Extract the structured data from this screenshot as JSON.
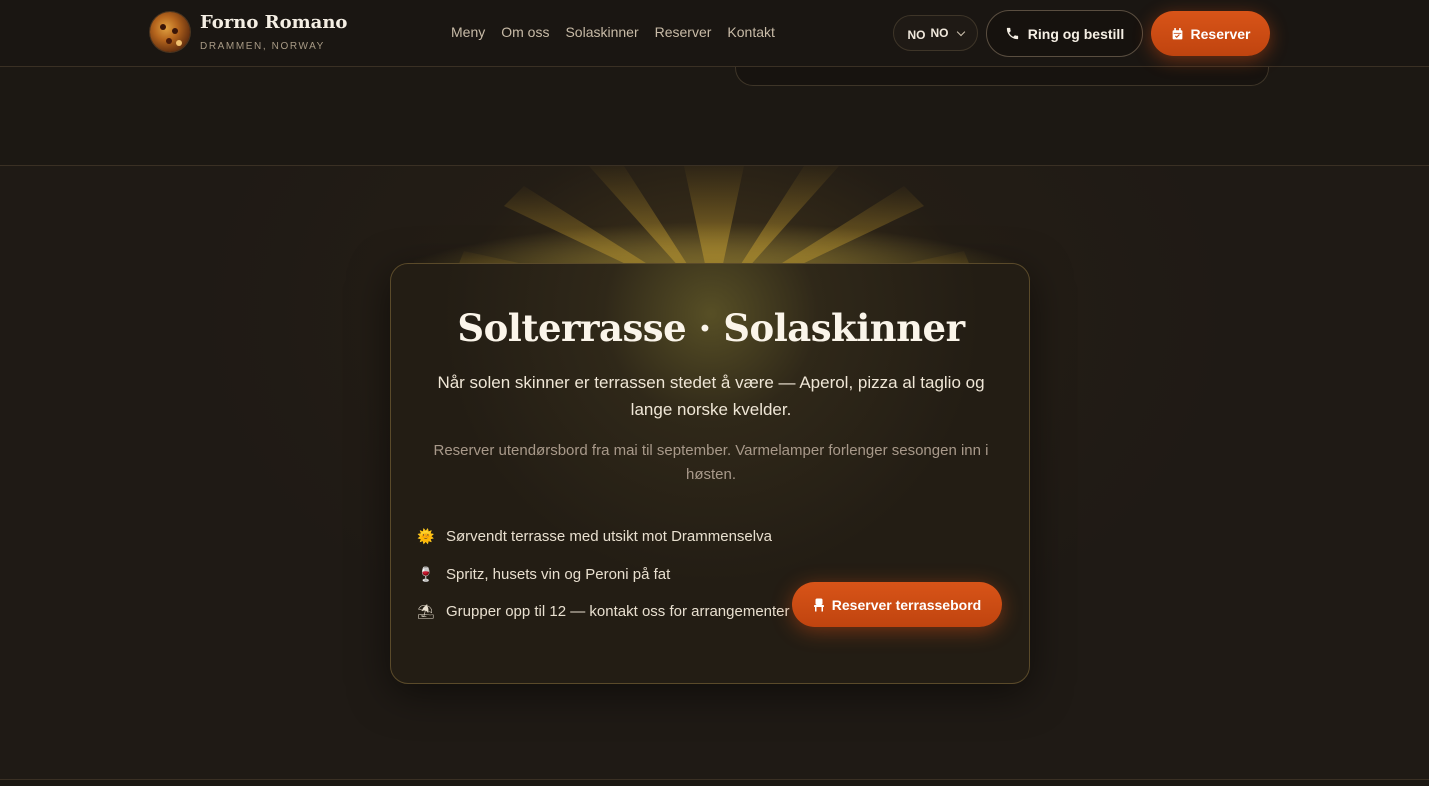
{
  "header": {
    "brand_name": "Forno Romano",
    "brand_sub": "DRAMMEN, NORWAY",
    "nav": [
      "Meny",
      "Om oss",
      "Solaskinner",
      "Reserver",
      "Kontakt"
    ],
    "lang_flag": "NO",
    "lang_label": "NO",
    "call_label": "Ring og bestill",
    "reserve_label": "Reserver"
  },
  "terrace": {
    "title": "Solterrasse · Solaskinner",
    "lead": "Når solen skinner er terrassen stedet å være — Aperol, pizza al taglio og lange norske kvelder.",
    "note": "Reserver utendørsbord fra mai til september. Varmelamper forlenger sesongen inn i høsten.",
    "features": [
      {
        "icon": "sun-icon",
        "glyph": "🌞",
        "text": "Sørvendt terrasse med utsikt mot Drammenselva"
      },
      {
        "icon": "wine-glass-icon",
        "glyph": "🍷",
        "text": "Spritz, husets vin og Peroni på fat"
      },
      {
        "icon": "beach-umbrella-icon",
        "glyph": "⛱",
        "text": "Grupper opp til 12 — kontakt oss for arrangementer"
      }
    ],
    "cta_label": "Reserver terrassebord"
  },
  "colors": {
    "accent": "#d1501a",
    "background": "#1c1813",
    "card_border": "#5a4a2a",
    "sun": "#e8c040"
  }
}
